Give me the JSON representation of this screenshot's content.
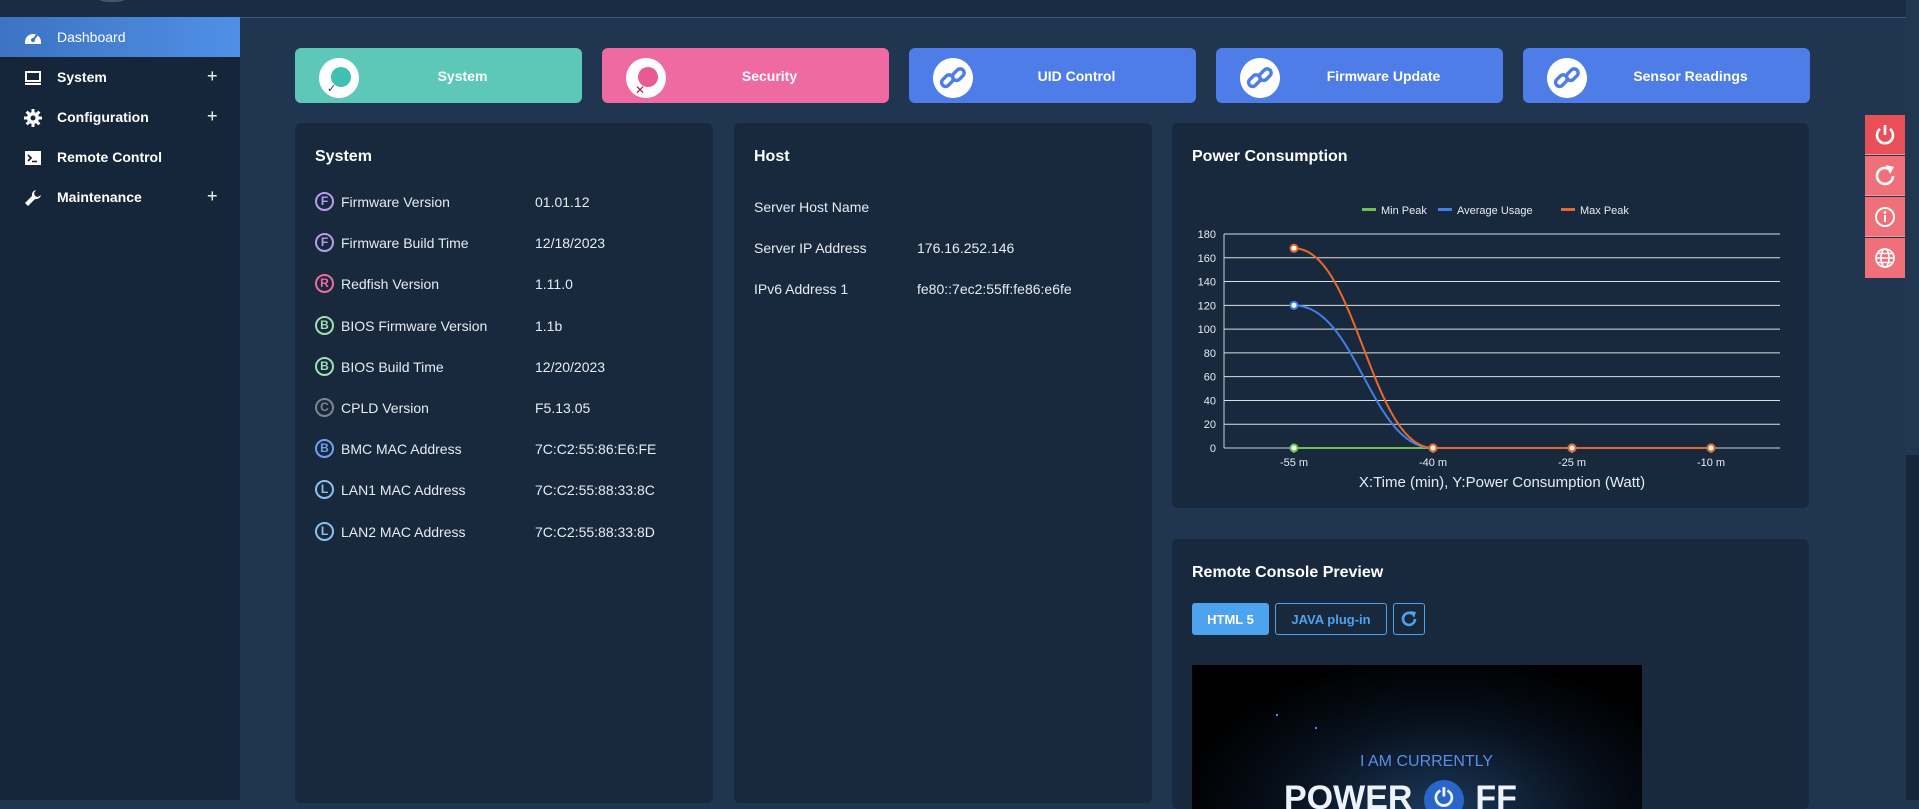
{
  "sidebar": {
    "items": [
      {
        "label": "Dashboard",
        "icon": "dashboard-icon",
        "active": true,
        "expandable": false
      },
      {
        "label": "System",
        "icon": "monitor-icon",
        "active": false,
        "expandable": true,
        "toggle": "+"
      },
      {
        "label": "Configuration",
        "icon": "gear-icon",
        "active": false,
        "expandable": true,
        "toggle": "+"
      },
      {
        "label": "Remote Control",
        "icon": "terminal-icon",
        "active": false,
        "expandable": false
      },
      {
        "label": "Maintenance",
        "icon": "wrench-icon",
        "active": false,
        "expandable": true,
        "toggle": "+"
      }
    ]
  },
  "tiles": [
    {
      "label": "System",
      "color": "#5ec8b8",
      "icon": "system-status-icon"
    },
    {
      "label": "Security",
      "color": "#ef6aa0",
      "icon": "security-status-icon"
    },
    {
      "label": "UID Control",
      "color": "#4f7de8",
      "icon": "link-icon"
    },
    {
      "label": "Firmware Update",
      "color": "#4f7de8",
      "icon": "link-icon"
    },
    {
      "label": "Sensor Readings",
      "color": "#4f7de8",
      "icon": "link-icon"
    }
  ],
  "system_panel": {
    "title": "System",
    "rows": [
      {
        "badge": "F",
        "badge_color": "#b89cf0",
        "label": "Firmware Version",
        "value": "01.01.12"
      },
      {
        "badge": "F",
        "badge_color": "#b89cf0",
        "label": "Firmware Build Time",
        "value": "12/18/2023"
      },
      {
        "badge": "R",
        "badge_color": "#ef6aa0",
        "label": "Redfish Version",
        "value": "1.11.0"
      },
      {
        "badge": "B",
        "badge_color": "#9fe0b0",
        "label": "BIOS Firmware Version",
        "value": "1.1b"
      },
      {
        "badge": "B",
        "badge_color": "#9fe0b0",
        "label": "BIOS Build Time",
        "value": "12/20/2023"
      },
      {
        "badge": "C",
        "badge_color": "#7d8591",
        "label": "CPLD Version",
        "value": "F5.13.05"
      },
      {
        "badge": "B",
        "badge_color": "#6ea2f0",
        "label": "BMC MAC Address",
        "value": "7C:C2:55:86:E6:FE"
      },
      {
        "badge": "L",
        "badge_color": "#8cc0f0",
        "label": "LAN1 MAC Address",
        "value": "7C:C2:55:88:33:8C"
      },
      {
        "badge": "L",
        "badge_color": "#8cc0f0",
        "label": "LAN2 MAC Address",
        "value": "7C:C2:55:88:33:8D"
      }
    ]
  },
  "host_panel": {
    "title": "Host",
    "rows": [
      {
        "label": "Server Host Name",
        "value": ""
      },
      {
        "label": "Server IP Address",
        "value": "176.16.252.146"
      },
      {
        "label": "IPv6 Address 1",
        "value": "fe80::7ec2:55ff:fe86:e6fe"
      }
    ]
  },
  "power_panel": {
    "title": "Power Consumption"
  },
  "chart_data": {
    "type": "line",
    "categories": [
      "-55 m",
      "-40 m",
      "-25 m",
      "-10 m"
    ],
    "series": [
      {
        "name": "Min Peak",
        "color": "#6cc24a",
        "values": [
          0,
          0,
          0,
          0
        ]
      },
      {
        "name": "Average Usage",
        "color": "#3f7fe6",
        "values": [
          120,
          0,
          0,
          0
        ]
      },
      {
        "name": "Max Peak",
        "color": "#e8672a",
        "values": [
          168,
          0,
          0,
          0
        ]
      }
    ],
    "ylim": [
      0,
      180
    ],
    "yticks": [
      0,
      20,
      40,
      60,
      80,
      100,
      120,
      140,
      160,
      180
    ],
    "xlabel": "X:Time (min), Y:Power Consumption (Watt)",
    "ylabel": "",
    "legend": "top-center",
    "grid": true
  },
  "console_panel": {
    "title": "Remote Console Preview",
    "html5_label": "HTML 5",
    "java_label": "JAVA plug-in",
    "refresh_icon": "refresh-icon",
    "screen_line1": "I AM CURRENTLY",
    "screen_line2a": "POWER",
    "screen_line2b": "FF"
  },
  "side_actions": [
    {
      "icon": "power-icon"
    },
    {
      "icon": "reload-icon"
    },
    {
      "icon": "info-icon"
    },
    {
      "icon": "globe-icon"
    }
  ],
  "colors": {
    "background": "#203550",
    "panel": "#19293d",
    "sidebar": "#16263a",
    "accent": "#4f90e6",
    "side_action": "#e84f57"
  }
}
